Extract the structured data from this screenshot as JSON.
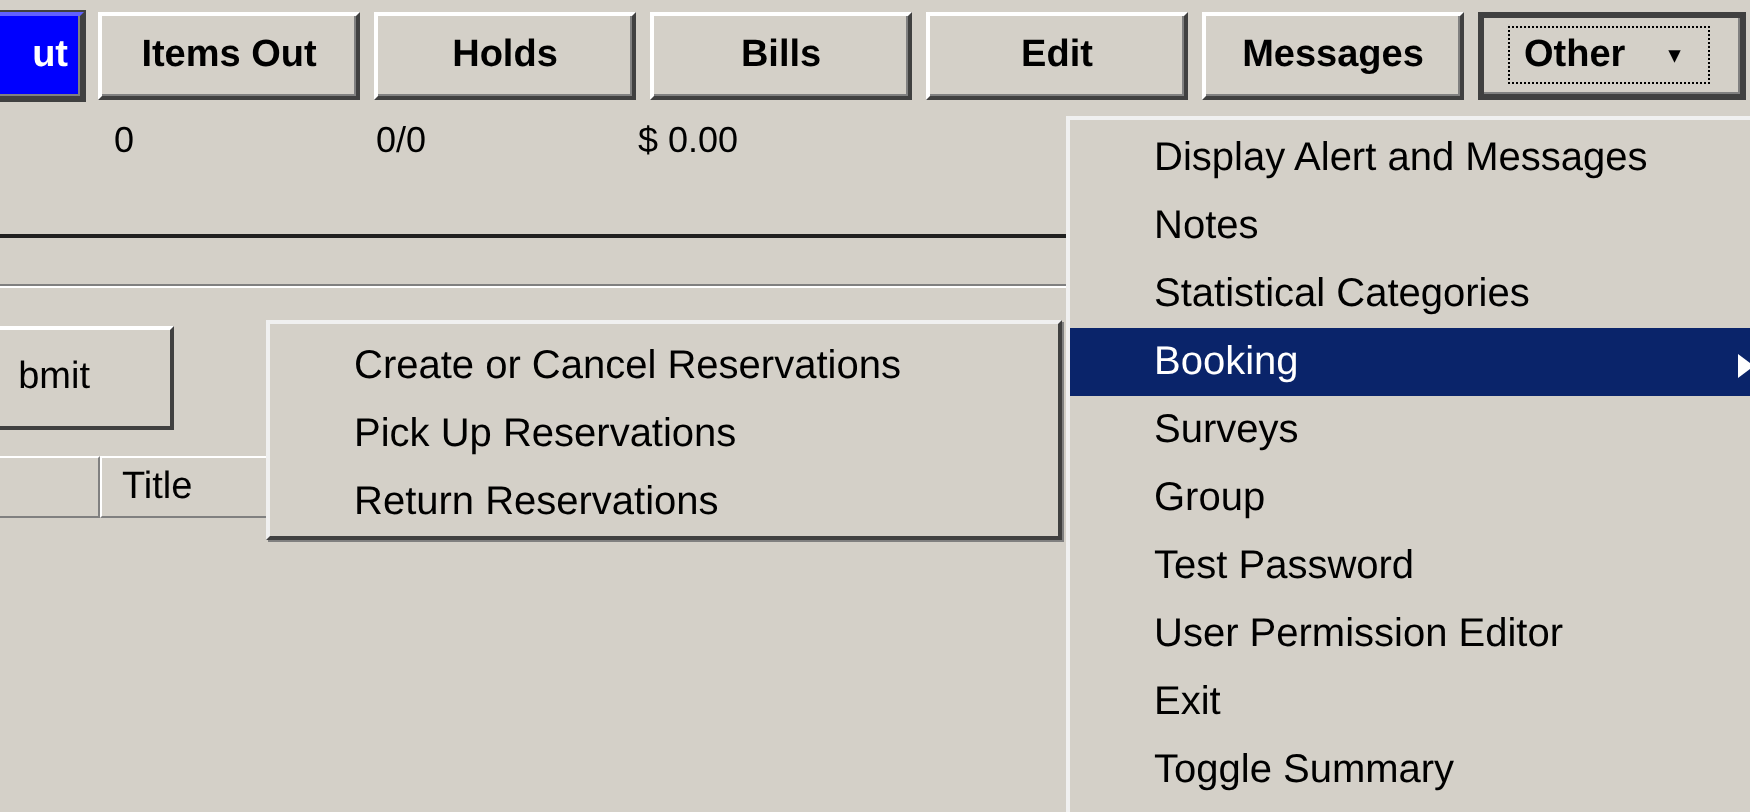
{
  "toolbar": [
    {
      "label": "ut",
      "selected": true,
      "focused": false,
      "kind": "button"
    },
    {
      "label": "Items Out",
      "selected": false,
      "focused": false,
      "kind": "button"
    },
    {
      "label": "Holds",
      "selected": false,
      "focused": false,
      "kind": "button"
    },
    {
      "label": "Bills",
      "selected": false,
      "focused": false,
      "kind": "button"
    },
    {
      "label": "Edit",
      "selected": false,
      "focused": false,
      "kind": "button"
    },
    {
      "label": "Messages",
      "selected": false,
      "focused": false,
      "kind": "button"
    },
    {
      "label": "Other",
      "selected": false,
      "focused": true,
      "kind": "dropdown",
      "caret": "▾"
    }
  ],
  "summary": [
    "0",
    "0/0",
    "$ 0.00"
  ],
  "submit_button": {
    "label": "bmit"
  },
  "table": {
    "columns": [
      "Title"
    ]
  },
  "other_menu": [
    {
      "label": "Display Alert and Messages",
      "selected": false,
      "submenu": false
    },
    {
      "label": "Notes",
      "selected": false,
      "submenu": false
    },
    {
      "label": "Statistical Categories",
      "selected": false,
      "submenu": false
    },
    {
      "label": "Booking",
      "selected": true,
      "submenu": true
    },
    {
      "label": "Surveys",
      "selected": false,
      "submenu": false
    },
    {
      "label": "Group",
      "selected": false,
      "submenu": false
    },
    {
      "label": "Test Password",
      "selected": false,
      "submenu": false
    },
    {
      "label": "User Permission Editor",
      "selected": false,
      "submenu": false
    },
    {
      "label": "Exit",
      "selected": false,
      "submenu": false
    },
    {
      "label": "Toggle Summary",
      "selected": false,
      "submenu": false
    }
  ],
  "booking_submenu": [
    {
      "label": "Create or Cancel Reservations",
      "selected": false
    },
    {
      "label": "Pick Up Reservations",
      "selected": false
    },
    {
      "label": "Return Reservations",
      "selected": false
    }
  ]
}
